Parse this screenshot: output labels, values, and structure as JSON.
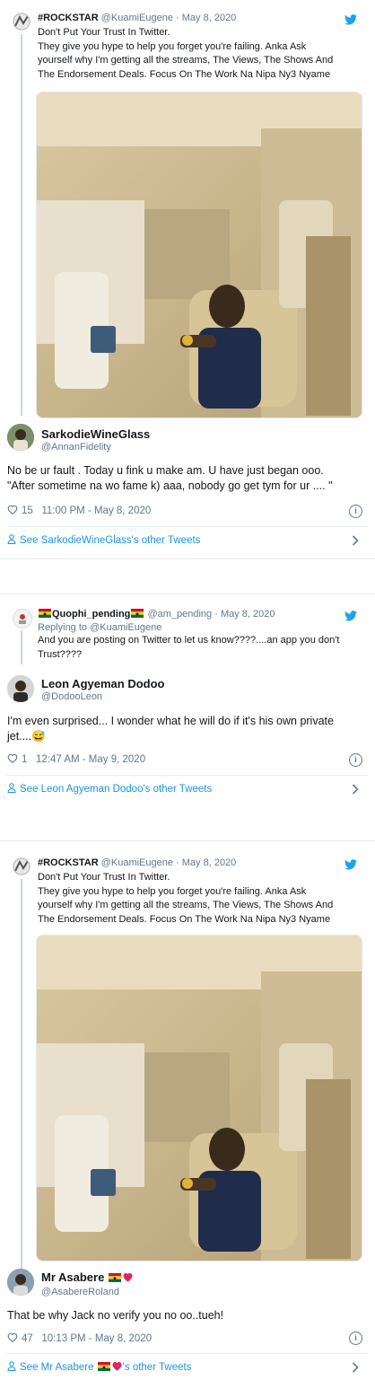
{
  "threads": [
    {
      "quoted": {
        "name": "#ROCKSTAR",
        "handle": "@KuamiEugene",
        "date": "· May 8, 2020",
        "lines": [
          "Don't Put Your Trust In Twitter.",
          "They give you hype to help you forget you're failing. Anka Ask",
          "yourself why I'm getting all the streams, The Views, The Shows And",
          "The Endorsement Deals. Focus On The Work Na Nipa Ny3 Nyame"
        ]
      },
      "reply": {
        "name": "SarkodieWineGlass",
        "handle": "@AnnanFidelity",
        "lines": [
          "No be ur fault . Today u fink u make am. U have just began ooo.",
          "\"After sometime na wo fame k) aaa, nobody go get tym for ur .... \""
        ],
        "likes": "15",
        "time": "11:00 PM - May 8, 2020",
        "see_other": "See SarkodieWineGlass's other Tweets"
      }
    },
    {
      "quoted": {
        "name": "Quophi_pending",
        "handle": "@am_pending",
        "date": "· May 8, 2020",
        "replying": "Replying to @KuamiEugene",
        "lines": [
          "And you are posting on Twitter to let us know????....an app you don't",
          "Trust????"
        ]
      },
      "reply": {
        "name": "Leon Agyeman Dodoo",
        "handle": "@DodooLeon",
        "lines": [
          "I'm even surprised... I wonder what he will do if it's his own private",
          "jet....😅"
        ],
        "likes": "1",
        "time": "12:47 AM - May 9, 2020",
        "see_other": "See Leon Agyeman Dodoo's other Tweets"
      }
    },
    {
      "quoted": {
        "name": "#ROCKSTAR",
        "handle": "@KuamiEugene",
        "date": "· May 8, 2020",
        "lines": [
          "Don't Put Your Trust In Twitter.",
          "They give you hype to help you forget you're failing. Anka Ask",
          "yourself why I'm getting all the streams, The Views, The Shows And",
          "The Endorsement Deals. Focus On The Work Na Nipa Ny3 Nyame"
        ]
      },
      "reply": {
        "name": "Mr Asabere",
        "handle": "@AsabereRoland",
        "lines": [
          "That be why Jack no verify you no oo..tueh!"
        ],
        "likes": "47",
        "time": "10:13 PM - May 8, 2020",
        "see_other_prefix": "See Mr Asabere",
        "see_other_suffix": "'s other Tweets"
      }
    }
  ],
  "colors": {
    "link": "#1b95e0",
    "twitter_blue": "#1da1f2",
    "muted": "#657786"
  },
  "icons": [
    "twitter-bird-icon",
    "heart-icon",
    "info-icon",
    "person-icon",
    "chevron-right-icon",
    "ghana-flag-icon",
    "red-heart-icon"
  ]
}
